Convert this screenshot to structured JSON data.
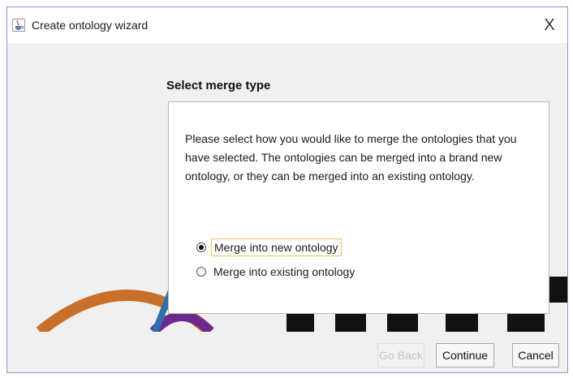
{
  "window": {
    "title": "Create ontology wizard",
    "close_label": "X"
  },
  "page": {
    "heading": "Select merge type",
    "description": "Please select how you would like to merge the ontologies that you have selected. The ontologies can be merged into a brand new ontology, or they can be merged into an existing ontology."
  },
  "options": [
    {
      "label": "Merge into new ontology",
      "selected": true
    },
    {
      "label": "Merge into existing ontology",
      "selected": false
    }
  ],
  "buttons": {
    "back": "Go Back",
    "continue": "Continue",
    "cancel": "Cancel"
  },
  "colors": {
    "arc_orange": "#c8702a",
    "arc_purple": "#6a2a8f",
    "arc_blue": "#2f6fa8"
  }
}
